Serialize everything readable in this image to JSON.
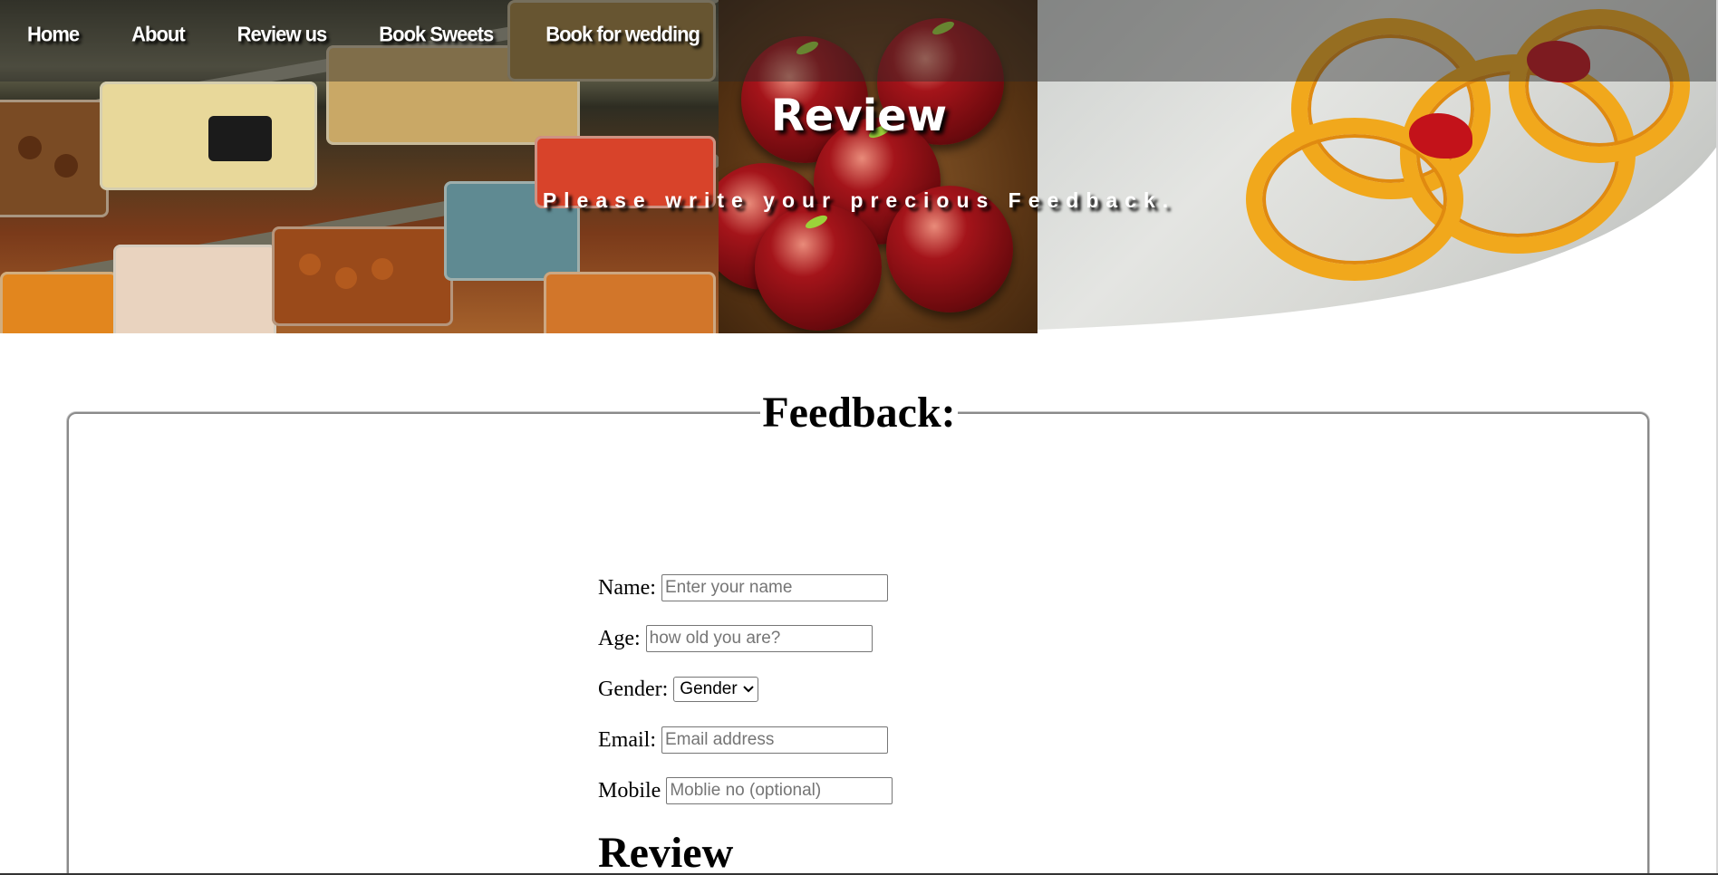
{
  "nav": {
    "items": [
      {
        "label": "Home"
      },
      {
        "label": "About"
      },
      {
        "label": "Review us"
      },
      {
        "label": "Book Sweets"
      },
      {
        "label": "Book for wedding"
      }
    ]
  },
  "hero": {
    "title": "Review",
    "subtitle": "Please write your precious Feedback."
  },
  "feedback": {
    "legend": "Feedback:",
    "fields": {
      "name": {
        "label": "Name:",
        "placeholder": "Enter your name",
        "value": ""
      },
      "age": {
        "label": "Age:",
        "placeholder": "how old you are?",
        "value": ""
      },
      "gender": {
        "label": "Gender:",
        "selected": "Gender"
      },
      "email": {
        "label": "Email:",
        "placeholder": "Email address",
        "value": ""
      },
      "mobile": {
        "label": "Mobile",
        "placeholder": "Moblie no (optional)",
        "value": ""
      }
    },
    "review_heading": "Review"
  },
  "colors": {
    "nav_text": "#ffffff",
    "fieldset_border": "#8a8a8a",
    "jalebi": "#f1a81c",
    "gulab_jamun": "#8b0f14"
  },
  "icons": {
    "select_arrow": "chevron-down-icon"
  }
}
